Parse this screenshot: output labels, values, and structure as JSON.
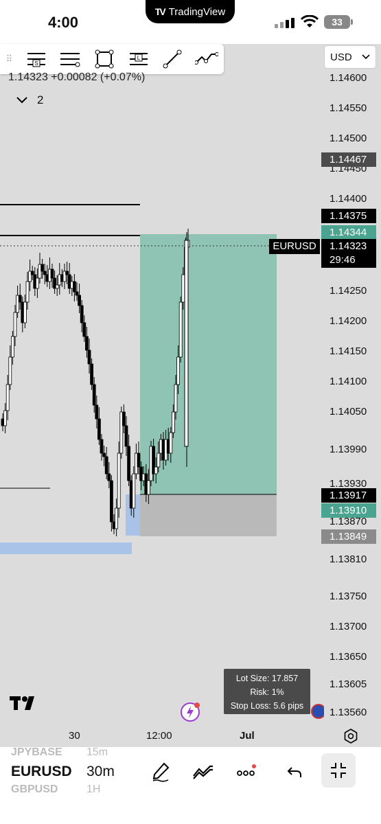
{
  "status_bar": {
    "time": "4:00",
    "app_pill": "TradingView",
    "battery": "33"
  },
  "toolbar": {
    "handle": "⠿",
    "tools": [
      "horizontal-ray-icon",
      "lines-icon",
      "rectangle-icon",
      "long-position-icon",
      "trend-line-icon",
      "path-icon"
    ]
  },
  "currency_select": {
    "value": "USD"
  },
  "legend": {
    "ohlc": "1.14323 +0.00082 (+0.07%)",
    "collapse_count": "2"
  },
  "price_axis": {
    "ticks": [
      "1.14600",
      "1.14550",
      "1.14500",
      "1.14450",
      "1.14400",
      "1.14250",
      "1.14200",
      "1.14150",
      "1.14100",
      "1.14050",
      "1.13990",
      "1.13930",
      "1.13870",
      "1.13810",
      "1.13750",
      "1.13700",
      "1.13650",
      "1.13605",
      "1.13560"
    ],
    "labels": [
      {
        "value": "1.14467",
        "color": "#4b4b4b"
      },
      {
        "value": "1.14375",
        "color": "#000000"
      },
      {
        "value": "1.14344",
        "color": "#4aa48f"
      },
      {
        "value": "1.13917",
        "color": "#000000"
      },
      {
        "value": "1.13910",
        "color": "#4aa48f"
      },
      {
        "value": "1.13849",
        "color": "#8a8a8a"
      }
    ],
    "current": {
      "symbol": "EURUSD",
      "price": "1.14323",
      "countdown": "29:46"
    }
  },
  "position_info": {
    "lot_size": "Lot Size: 17.857",
    "risk": "Risk: 1%",
    "stop_loss": "Stop Loss: 5.6 pips"
  },
  "time_axis": {
    "labels": [
      "30",
      "12:00",
      "Jul"
    ]
  },
  "bottom_bar": {
    "prev_symbol": "JPYBASE",
    "prev_tf": "15m",
    "symbol": "EURUSD",
    "timeframe": "30m",
    "next_symbol": "GBPUSD",
    "next_tf": "1H"
  },
  "colors": {
    "target_zone": "#8fc3b3",
    "stop_zone": "#b9b9b9",
    "demand_zone": "#a9c2e8",
    "accent_green": "#4aa48f"
  }
}
